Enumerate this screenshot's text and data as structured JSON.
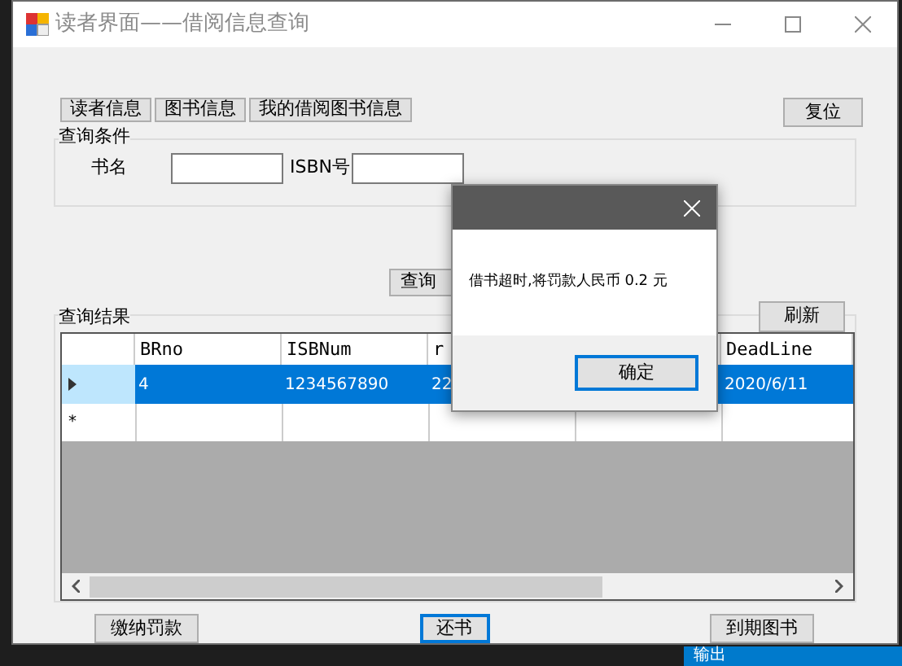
{
  "window": {
    "title": "读者界面——借阅信息查询"
  },
  "nav_buttons": [
    {
      "label": "读者信息"
    },
    {
      "label": "图书信息"
    },
    {
      "label": "我的借阅图书信息"
    }
  ],
  "reset_button": {
    "label": "复位"
  },
  "query_group": {
    "title": "查询条件",
    "fields": [
      {
        "label": "书名"
      },
      {
        "label": "ISBN号"
      }
    ]
  },
  "query_button": {
    "label": "查询"
  },
  "results_group": {
    "title": "查询结果",
    "refresh_button": {
      "label": "刷新"
    },
    "table": {
      "columns": [
        {
          "label": "BRno"
        },
        {
          "label": "ISBNum"
        },
        {
          "label": "r"
        },
        {},
        {
          "label": "DeadLine"
        }
      ],
      "rows": [
        {
          "selected": true,
          "cells": [
            "4",
            "1234567890",
            "22",
            null,
            "2020/6/11"
          ]
        }
      ],
      "new_row_marker": "*"
    }
  },
  "bottom_buttons": [
    {
      "label": "缴纳罚款",
      "focused": false
    },
    {
      "label": "还书",
      "focused": true
    },
    {
      "label": "到期图书",
      "focused": false
    }
  ],
  "dialog": {
    "message": "借书超时,将罚款人民币 0.2 元",
    "ok_button": {
      "label": "确定"
    }
  },
  "background_tab": {
    "label": "输出"
  }
}
